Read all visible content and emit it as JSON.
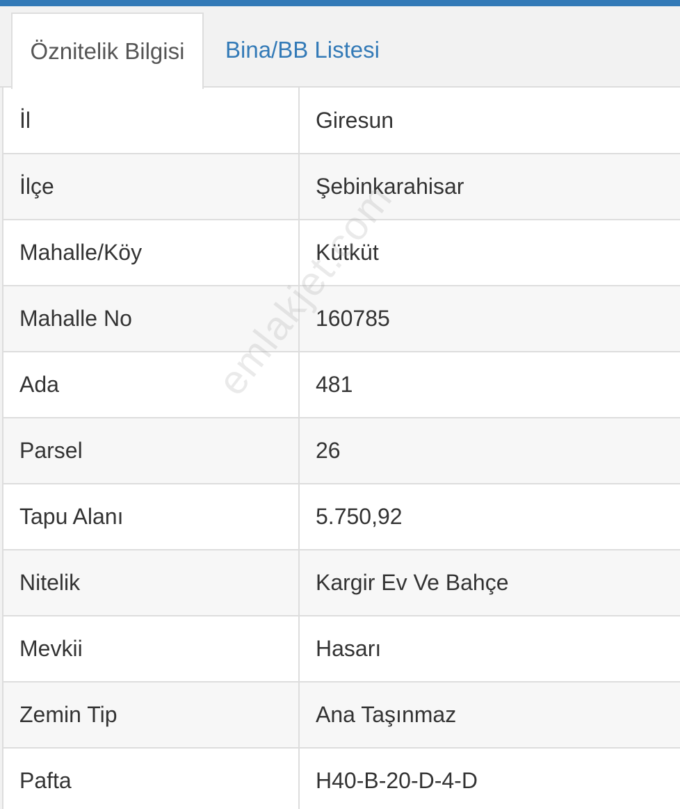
{
  "tabs": [
    {
      "label": "Öznitelik Bilgisi",
      "active": true
    },
    {
      "label": "Bina/BB Listesi",
      "active": false
    }
  ],
  "rows": [
    {
      "key": "İl",
      "value": "Giresun"
    },
    {
      "key": "İlçe",
      "value": "Şebinkarahisar"
    },
    {
      "key": "Mahalle/Köy",
      "value": "Kütküt"
    },
    {
      "key": "Mahalle No",
      "value": "160785"
    },
    {
      "key": "Ada",
      "value": "481"
    },
    {
      "key": "Parsel",
      "value": "26"
    },
    {
      "key": "Tapu Alanı",
      "value": "5.750,92"
    },
    {
      "key": "Nitelik",
      "value": "Kargir Ev Ve Bahçe"
    },
    {
      "key": "Mevkii",
      "value": "Hasarı"
    },
    {
      "key": "Zemin Tip",
      "value": "Ana Taşınmaz"
    },
    {
      "key": "Pafta",
      "value": "H40-B-20-D-4-D"
    }
  ],
  "watermark": "emlakjet.com",
  "colors": {
    "accent": "#337ab7",
    "border": "#dddddd",
    "text": "#333333"
  }
}
